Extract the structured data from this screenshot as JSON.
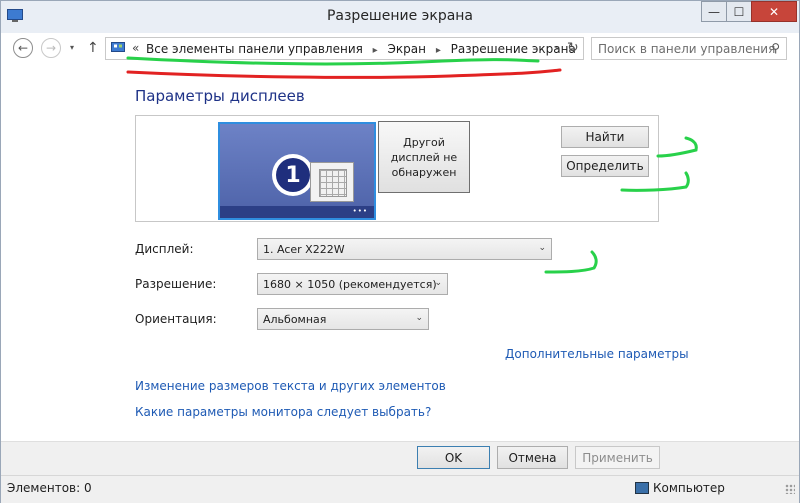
{
  "window": {
    "title": "Разрешение экрана",
    "controls": {
      "minimize": "—",
      "maximize": "☐",
      "close": "✕"
    }
  },
  "nav": {
    "back_glyph": "←",
    "forward_glyph": "→",
    "recent_glyph": "▾",
    "up_glyph": "↑",
    "address_chevron": "«",
    "breadcrumb": [
      "Все элементы панели управления",
      "Экран",
      "Разрешение экрана"
    ],
    "breadcrumb_sep": "▸",
    "address_dropdown": "⌄",
    "refresh_glyph": "↻",
    "search_placeholder": "Поиск в панели управления",
    "search_glyph": "⚲"
  },
  "main": {
    "section_title": "Параметры дисплеев",
    "monitor1_number": "1",
    "monitor1_dots": "•••",
    "monitor2_text": "Другой дисплей не обнаружен",
    "find_label": "Найти",
    "identify_label": "Определить",
    "settings": [
      {
        "label": "Дисплей:",
        "value": "1. Acer X222W"
      },
      {
        "label": "Разрешение:",
        "value": "1680 × 1050 (рекомендуется)"
      },
      {
        "label": "Ориентация:",
        "value": "Альбомная"
      }
    ],
    "dropdown_arrow": "⌄",
    "advanced_link": "Дополнительные параметры",
    "links": [
      "Изменение размеров текста и других элементов",
      "Какие параметры монитора следует выбрать?"
    ]
  },
  "footer": {
    "ok": "OK",
    "cancel": "Отмена",
    "apply": "Применить"
  },
  "status": {
    "items": "Элементов: 0",
    "location": "Компьютер"
  },
  "colors": {
    "accent": "#1e3287",
    "link": "#1e5ab4",
    "annotation_green": "#28d14a",
    "annotation_red": "#e22222"
  }
}
